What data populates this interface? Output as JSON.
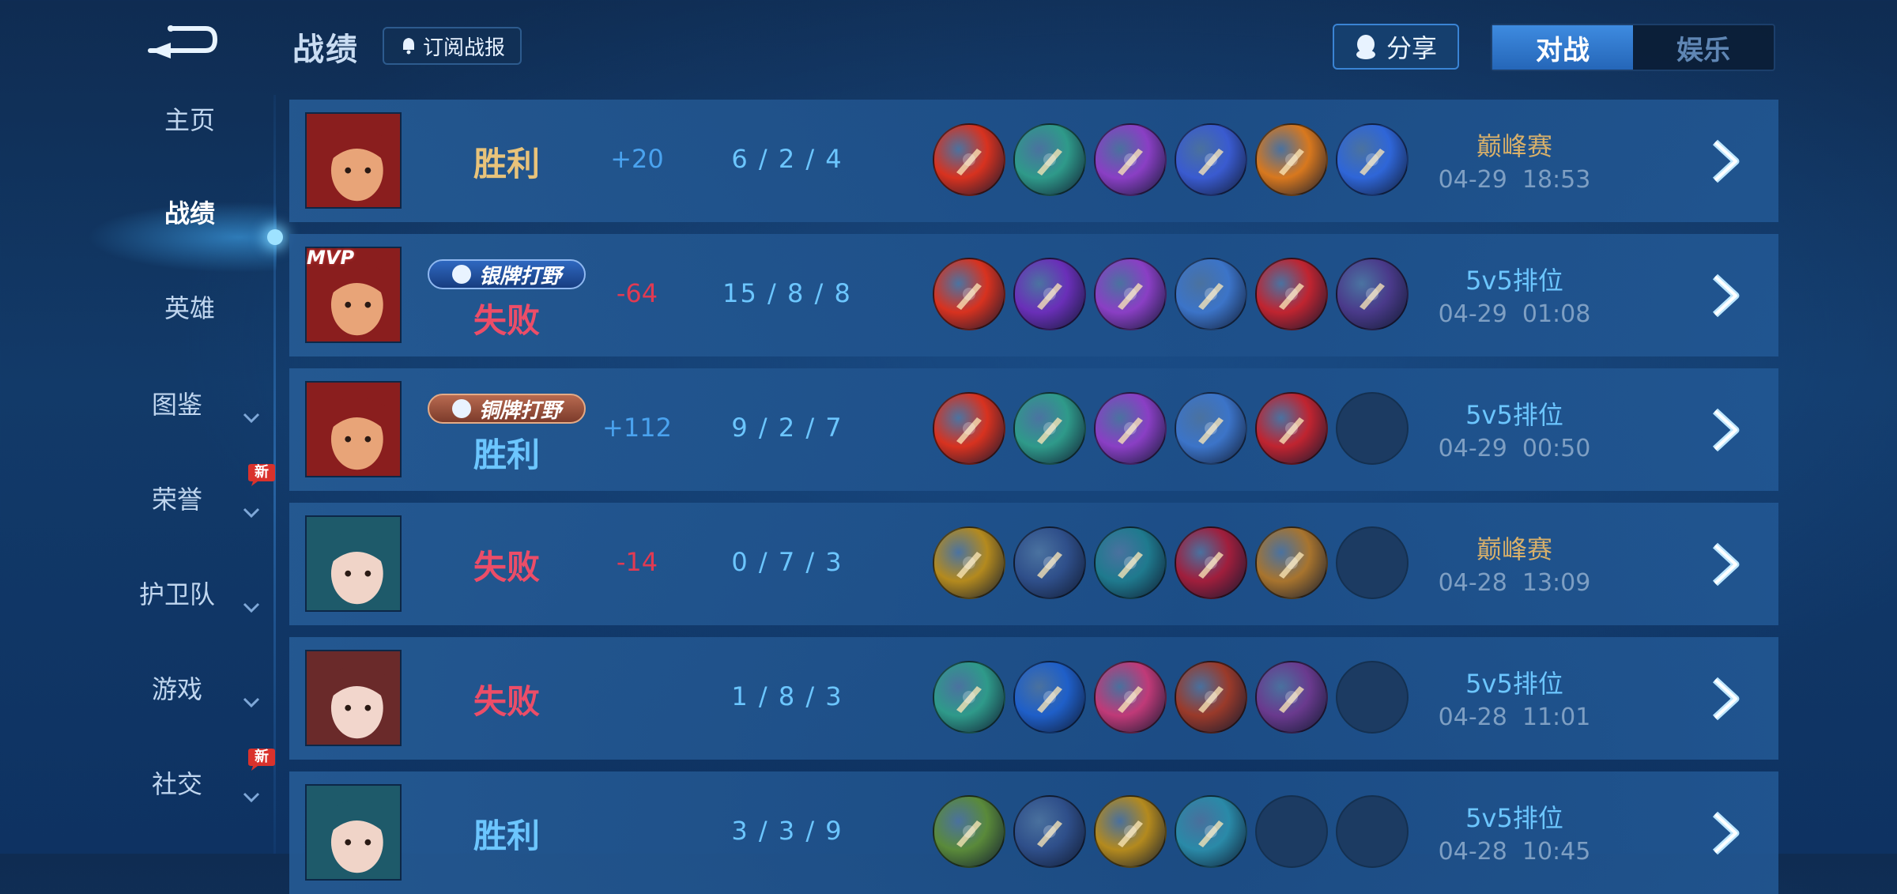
{
  "header": {
    "title": "战绩",
    "subscribe_label": "订阅战报",
    "share_label": "分享",
    "tabs": [
      {
        "label": "对战",
        "active": true
      },
      {
        "label": "娱乐",
        "active": false
      }
    ]
  },
  "sidebar": {
    "items": [
      {
        "label": "主页",
        "active": false,
        "has_chevron": false,
        "new": false
      },
      {
        "label": "战绩",
        "active": true,
        "has_chevron": false,
        "new": false
      },
      {
        "label": "英雄",
        "active": false,
        "has_chevron": false,
        "new": false
      },
      {
        "label": "图鉴",
        "active": false,
        "has_chevron": true,
        "new": false
      },
      {
        "label": "荣誉",
        "active": false,
        "has_chevron": true,
        "new": true
      },
      {
        "label": "护卫队",
        "active": false,
        "has_chevron": true,
        "new": false
      },
      {
        "label": "游戏",
        "active": false,
        "has_chevron": true,
        "new": false
      },
      {
        "label": "社交",
        "active": false,
        "has_chevron": true,
        "new": true
      }
    ],
    "new_badge_label": "新"
  },
  "matches": [
    {
      "hero": "hero-red-hat",
      "mvp": false,
      "rank_badge": null,
      "result": "胜利",
      "result_style": "win-gold",
      "points": "+20",
      "points_style": "plus",
      "kda": "6 / 2 / 4",
      "items": [
        "sword-red-icon",
        "boots-green-icon",
        "axe-purple-icon",
        "spiked-star-icon",
        "blade-orange-icon",
        "trident-blue-icon"
      ],
      "mode": "巅峰赛",
      "mode_style": "peak",
      "time": "04-29  18:53"
    },
    {
      "hero": "hero-red-hat",
      "mvp": true,
      "mvp_label": "MVP",
      "rank_badge": {
        "label": "银牌打野",
        "style": "silver"
      },
      "result": "失败",
      "result_style": "loss",
      "points": "-64",
      "points_style": "minus",
      "kda": "15 / 8 / 8",
      "items": [
        "sword-red-icon",
        "spear-purple-icon",
        "axe-purple-icon",
        "halberd-blue-icon",
        "crystal-red-icon",
        "armor-dark-icon"
      ],
      "mode": "5v5排位",
      "mode_style": "rank",
      "time": "04-29  01:08"
    },
    {
      "hero": "hero-red-hat",
      "mvp": false,
      "rank_badge": {
        "label": "铜牌打野",
        "style": "bronze"
      },
      "result": "胜利",
      "result_style": "win-blue",
      "points": "+112",
      "points_style": "plus",
      "kda": "9 / 2 / 7",
      "items": [
        "sword-red-icon",
        "boots-green-icon",
        "axe-purple-icon",
        "halberd-blue-icon",
        "crystal-red-icon",
        null
      ],
      "mode": "5v5排位",
      "mode_style": "rank",
      "time": "04-29  00:50"
    },
    {
      "hero": "hero-teal-hair",
      "mvp": false,
      "rank_badge": null,
      "result": "失败",
      "result_style": "loss",
      "points": "-14",
      "points_style": "minus",
      "kda": "0 / 7 / 3",
      "items": [
        "helmet-gold-icon",
        "boots-blue-icon",
        "scythe-teal-icon",
        "hood-red-icon",
        "crate-wood-icon",
        null
      ],
      "mode": "巅峰赛",
      "mode_style": "peak",
      "time": "04-28  13:09"
    },
    {
      "hero": "hero-white-hair",
      "mvp": false,
      "rank_badge": null,
      "result": "失败",
      "result_style": "loss",
      "points": "",
      "points_style": "plus",
      "kda": "1 / 8 / 3",
      "items": [
        "boots-green-icon",
        "orb-blue-icon",
        "gauntlet-pink-icon",
        "book-red-icon",
        "tome-purple-icon",
        null
      ],
      "mode": "5v5排位",
      "mode_style": "rank",
      "time": "04-28  11:01"
    },
    {
      "hero": "hero-teal-hair",
      "mvp": false,
      "rank_badge": null,
      "result": "胜利",
      "result_style": "win-blue",
      "points": "",
      "points_style": "plus",
      "kda": "3 / 3 / 9",
      "items": [
        "scroll-green-icon",
        "boots-blue-icon",
        "helmet-gold-icon",
        "amulet-teal-icon",
        null,
        null
      ],
      "mode": "5v5排位",
      "mode_style": "rank",
      "time": "04-28  10:45"
    }
  ],
  "colors": {
    "item_palette": {
      "sword-red-icon": "#d8321f",
      "boots-green-icon": "#2f9a8a",
      "axe-purple-icon": "#8a3fc4",
      "spiked-star-icon": "#3a5bd0",
      "blade-orange-icon": "#d8781e",
      "trident-blue-icon": "#2f66d8",
      "spear-purple-icon": "#6a2fb8",
      "halberd-blue-icon": "#3c74c8",
      "crystal-red-icon": "#c02430",
      "armor-dark-icon": "#4a3a8a",
      "helmet-gold-icon": "#b48a1e",
      "boots-blue-icon": "#2f4f8a",
      "scythe-teal-icon": "#1f7a8e",
      "hood-red-icon": "#a01e3c",
      "crate-wood-icon": "#a8742e",
      "orb-blue-icon": "#1f5fc8",
      "gauntlet-pink-icon": "#c03a78",
      "book-red-icon": "#9a3a2a",
      "tome-purple-icon": "#6a3a8e",
      "scroll-green-icon": "#5a8a3a",
      "amulet-teal-icon": "#2a8aa8"
    },
    "hero_palette": {
      "hero-red-hat": [
        "#8a1e1e",
        "#e8a478"
      ],
      "hero-teal-hair": [
        "#1e5a6a",
        "#f0d4c8"
      ],
      "hero-white-hair": [
        "#6a2a2a",
        "#f2d6cc"
      ]
    }
  }
}
